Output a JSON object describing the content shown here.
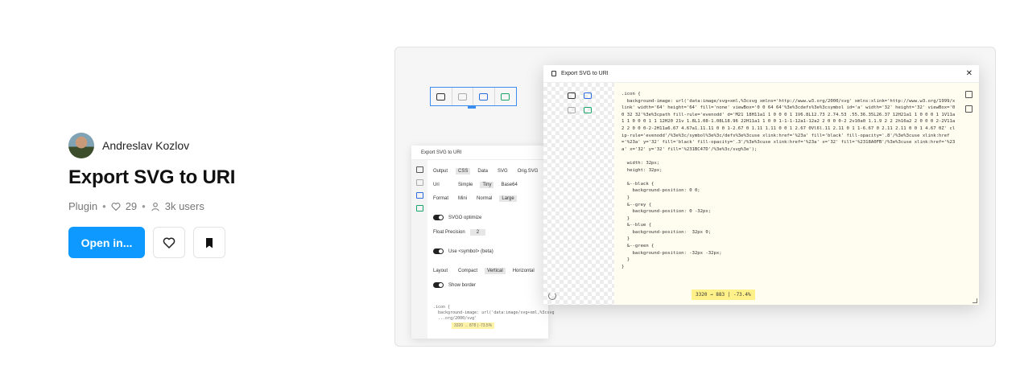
{
  "author": {
    "name": "Andreslav Kozlov"
  },
  "title": "Export SVG to URI",
  "meta": {
    "type": "Plugin",
    "likes": "29",
    "users": "3k users"
  },
  "actions": {
    "open_label": "Open in..."
  },
  "preview": {
    "small_window": {
      "title": "Export SVG to URI",
      "output_label": "Output",
      "output_options": [
        "CSS",
        "Data",
        "SVG",
        "Orig.SVG"
      ],
      "uri_label": "Uri",
      "uri_options": [
        "Simple",
        "Tiny",
        "Base64"
      ],
      "format_label": "Format",
      "format_options": [
        "Mini",
        "Normal",
        "Large"
      ],
      "svgo_label": "SVGO optimize",
      "precision_label": "Float Precision",
      "precision_value": "2",
      "use_symbols_label": "Use <symbol> (beta)",
      "layout_label": "Layout",
      "layout_options": [
        "Compact",
        "Vertical",
        "Horizontal"
      ],
      "border_label": "Show border",
      "code_text": ".icon {\n  background-image: url('data:image/svg+xml,%3csvg\n  ...org/2000/svg'",
      "stat": "3320 → 878 | -73.5%"
    },
    "main_window": {
      "title": "Export SVG to URI",
      "code": ".icon {\n  background-image: url('data:image/svg+xml,%3csvg xmlns='http://www.w3.org/2000/svg' xmlns:xlink='http://www.w3.org/1999/xlink' width='64' height='64' fill='none' viewBox='0 0 64 64'%3e%3cdefs%3e%3csymbol id='a' width='32' height='32' viewBox='0 0 32 32'%3e%3cpath fill-rule='evenodd' d='M21 18H11a1 1 0 0 0 1 1V6.8L12.73 2.74.53 .55.36.35L26.37 12H21a1 1 0 0 0 1 1V11a1 1 0 0 0 1 1 12H20 21v 1.8L1.08-1.08L18.96 22H11a1 1 0 0 1-1-1-12a1-12a2 2 0 0 0-2 2v10a0 1.1.9 2 2 2h16a2 2 0 0 0 2-2V11a2 2 0 0 0-2-2H11a6.67 4.67a1.11.11 0 0 1-2.67 0 1.11 1.11 0 0 1 2.67 0Vl6l.11 2.11 0 1 1-6.67 0 2.11 2.11 0 0 1 4.67 0Z' clip-rule='evenodd'/%3e%3c/symbol%3e%3c/defs%3e%3cuse xlink:href='%23a' fill='black' fill-opacity='.8'/%3e%3cuse xlink:href='%23a' y='32' fill='black' fill-opacity='.3'/%3e%3cuse xlink:href='%23a' x='32' fill='%2318A0FB'/%3e%3cuse xlink:href='%23a' x='32' y='32' fill='%231BC47D'/%3e%3c/svg%3e');\n\n  width: 32px;\n  height: 32px;\n\n  &--black {\n    background-position: 0 0;\n  }\n  &--grey {\n    background-position: 0 -32px;\n  }\n  &--blue {\n    background-position:  32px 0;\n  }\n  &--green {\n    background-position: -32px -32px;\n  }\n}",
      "result": "3320 → 883 | -73.4%"
    }
  }
}
